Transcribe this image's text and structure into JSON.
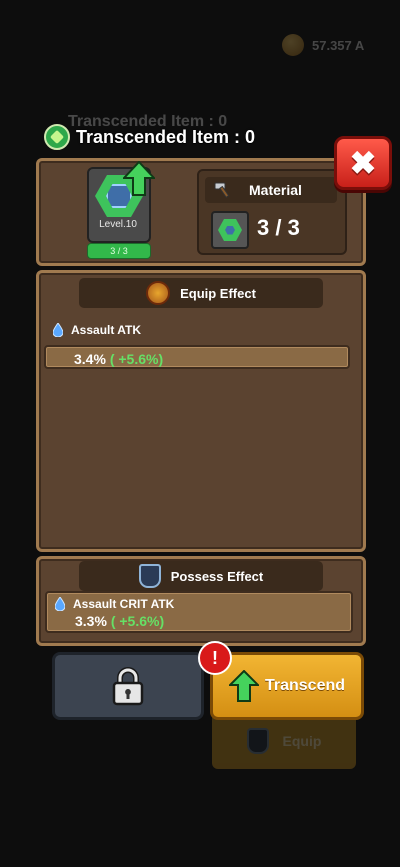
{
  "background": {
    "gold_amount": "57.357 A",
    "title": "Transcended Item : 0",
    "equip_label": "Equip"
  },
  "header": {
    "title": "Transcended Item : 0"
  },
  "item": {
    "level": "Level.10",
    "progress": "3 / 3"
  },
  "material": {
    "label": "Material",
    "count": "3 / 3"
  },
  "equip_effect": {
    "title": "Equip Effect",
    "stat_name": "Assault ATK",
    "value": "3.4%",
    "bonus": "( +5.6%)"
  },
  "possess_effect": {
    "title": "Possess Effect",
    "stat_name": "Assault CRIT ATK",
    "value": "3.3%",
    "bonus": "( +5.6%)"
  },
  "buttons": {
    "transcend_label": "Transcend",
    "alert_symbol": "!",
    "close_symbol": "✖"
  },
  "colors": {
    "panel": "#5b4330",
    "accent_gold": "#f2b533",
    "bonus_green": "#66e066",
    "close_red": "#e2372a"
  }
}
